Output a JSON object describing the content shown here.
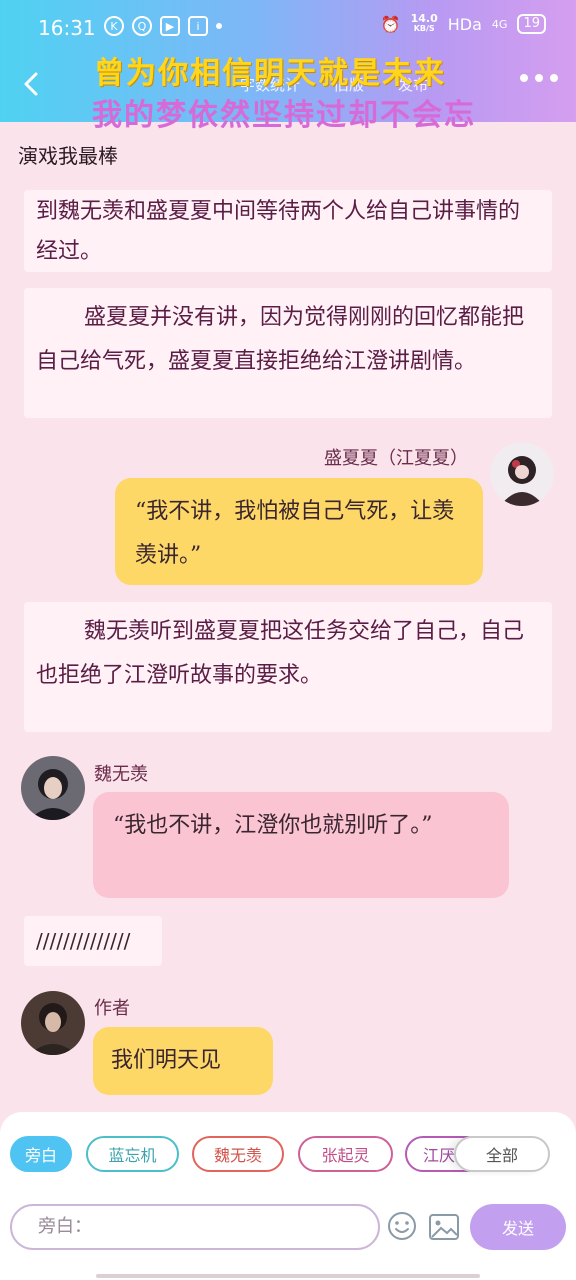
{
  "status_bar": {
    "time": "16:31",
    "network_speed_value": "14.0",
    "network_speed_unit": "KB/S",
    "network_label": "HDa",
    "signal_label": "4G",
    "battery": "19"
  },
  "header": {
    "tabs": [
      "字数统计",
      "旧版",
      "发布"
    ],
    "overlay_line1": "曾为你相信明天就是未来",
    "overlay_line2": "我的梦依然坚持过却不会忘"
  },
  "subtitle": "演戏我最棒",
  "messages": [
    {
      "type": "narration",
      "text": "到魏无羡和盛夏夏中间等待两个人给自己讲事情的经过。"
    },
    {
      "type": "narration",
      "text": "盛夏夏并没有讲，因为觉得刚刚的回忆都能把自己给气死，盛夏夏直接拒绝给江澄讲剧情。"
    },
    {
      "type": "bubble",
      "side": "right",
      "name": "盛夏夏（江夏夏）",
      "text": "“我不讲，我怕被自己气死，让羡羡讲。”"
    },
    {
      "type": "narration",
      "text": "魏无羡听到盛夏夏把这任务交给了自己，自己也拒绝了江澄听故事的要求。"
    },
    {
      "type": "bubble",
      "side": "left",
      "name": "魏无羡",
      "text": "“我也不讲，江澄你也就别听了。”"
    },
    {
      "type": "narration",
      "text": "//////////////"
    },
    {
      "type": "bubble",
      "side": "left",
      "name": "作者",
      "text": "我们明天见"
    }
  ],
  "roles": [
    {
      "label": "旁白",
      "color": "#4fc3f1",
      "active": true
    },
    {
      "label": "蓝忘机",
      "color": "#4bbfc9",
      "active": false
    },
    {
      "label": "魏无羡",
      "color": "#e2655c",
      "active": false
    },
    {
      "label": "张起灵",
      "color": "#d0609a",
      "active": false
    },
    {
      "label": "江厌",
      "color": "#b55bb6",
      "active": false
    },
    {
      "label": "全部",
      "color": "#bdbdbd",
      "active": false
    }
  ],
  "composer": {
    "placeholder": "旁白：",
    "send_label": "发送"
  }
}
